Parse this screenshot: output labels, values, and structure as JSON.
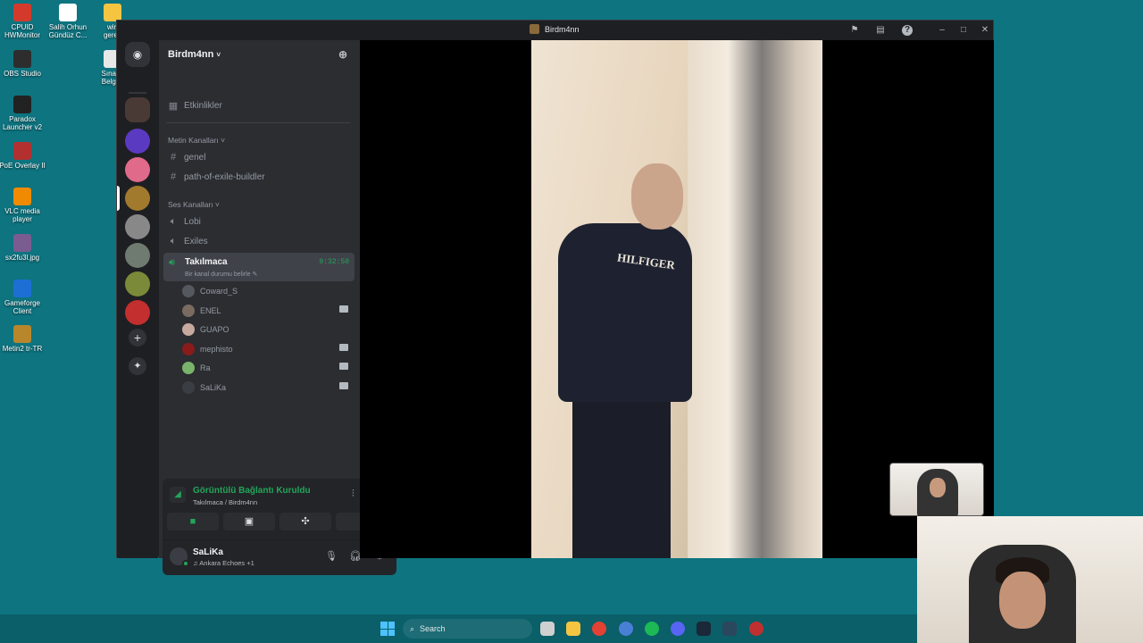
{
  "desktop": {
    "icons": [
      {
        "label": "CPUID\nHWMonitor",
        "color": "#d33a2c"
      },
      {
        "label": "OBS Studio",
        "color": "#2d2d2d"
      },
      {
        "label": "Paradox\nLauncher v2",
        "color": "#222222"
      },
      {
        "label": "PoE Overlay II",
        "color": "#b33030"
      },
      {
        "label": "VLC media\nplayer",
        "color": "#f08a00"
      },
      {
        "label": "sx2fu3l.jpg",
        "color": "#7a5c90"
      },
      {
        "label": "Gameforge\nClient",
        "color": "#1d6fd6"
      },
      {
        "label": "Metin2 tr-TR",
        "color": "#b8862b"
      }
    ],
    "col2": [
      {
        "label": "Salih Orhun\nGündüz C...",
        "color": "#ffffff"
      },
      {
        "label": "win\ngerek",
        "color": "#f5c542"
      },
      {
        "label": "Sınava\nBelges",
        "color": "#e8e8e8"
      }
    ]
  },
  "window": {
    "title": "Birdm4nn",
    "controls": {
      "flag": "⚑",
      "inbox": "▤",
      "help": "?",
      "minimize": "–",
      "maximize": "□",
      "close": "✕"
    }
  },
  "server": {
    "name": "Birdm4nn",
    "events_label": "Etkinlikler",
    "text_category": "Metin Kanalları",
    "text_channels": [
      "genel",
      "path-of-exile-buildler"
    ],
    "voice_category": "Ses Kanalları",
    "voice_channels": [
      "Lobi",
      "Exiles"
    ],
    "active_channel": {
      "name": "Takılmaca",
      "timer": "9:32:50",
      "status": "Bir kanal durumu belirle"
    },
    "members": [
      {
        "name": "Coward_S",
        "camera": false,
        "color": "#55585f"
      },
      {
        "name": "ENEL",
        "camera": true,
        "color": "#7a6b60"
      },
      {
        "name": "GUAPO",
        "camera": false,
        "color": "#c7a9a0"
      },
      {
        "name": "mephisto",
        "camera": true,
        "color": "#8a1b1b"
      },
      {
        "name": "Ra",
        "camera": true,
        "color": "#7ab36b"
      },
      {
        "name": "SaLiKa",
        "camera": true,
        "color": "#3b3d44"
      }
    ]
  },
  "voice_panel": {
    "title": "Görüntülü Bağlantı Kuruldu",
    "subtitle": "Takılmaca / Birdm4nn",
    "buttons": [
      "camera",
      "screen-share",
      "activities",
      "soundboard"
    ]
  },
  "user": {
    "name": "SaLiKa",
    "activity": "Ankara Echoes +1"
  },
  "stage": {
    "shirt_text": "HILFIGER"
  },
  "taskbar": {
    "search_label": "Search",
    "apps": [
      {
        "name": "task-view",
        "color": "#d0d0d0"
      },
      {
        "name": "file-explorer",
        "color": "#f5c542"
      },
      {
        "name": "chrome",
        "color": "#e34133"
      },
      {
        "name": "app-blue",
        "color": "#4a7fd6"
      },
      {
        "name": "spotify",
        "color": "#1db954"
      },
      {
        "name": "discord",
        "color": "#5865f2"
      },
      {
        "name": "steam",
        "color": "#1b2838"
      },
      {
        "name": "steam-2",
        "color": "#2a475e"
      },
      {
        "name": "app-red",
        "color": "#c03030"
      }
    ]
  }
}
